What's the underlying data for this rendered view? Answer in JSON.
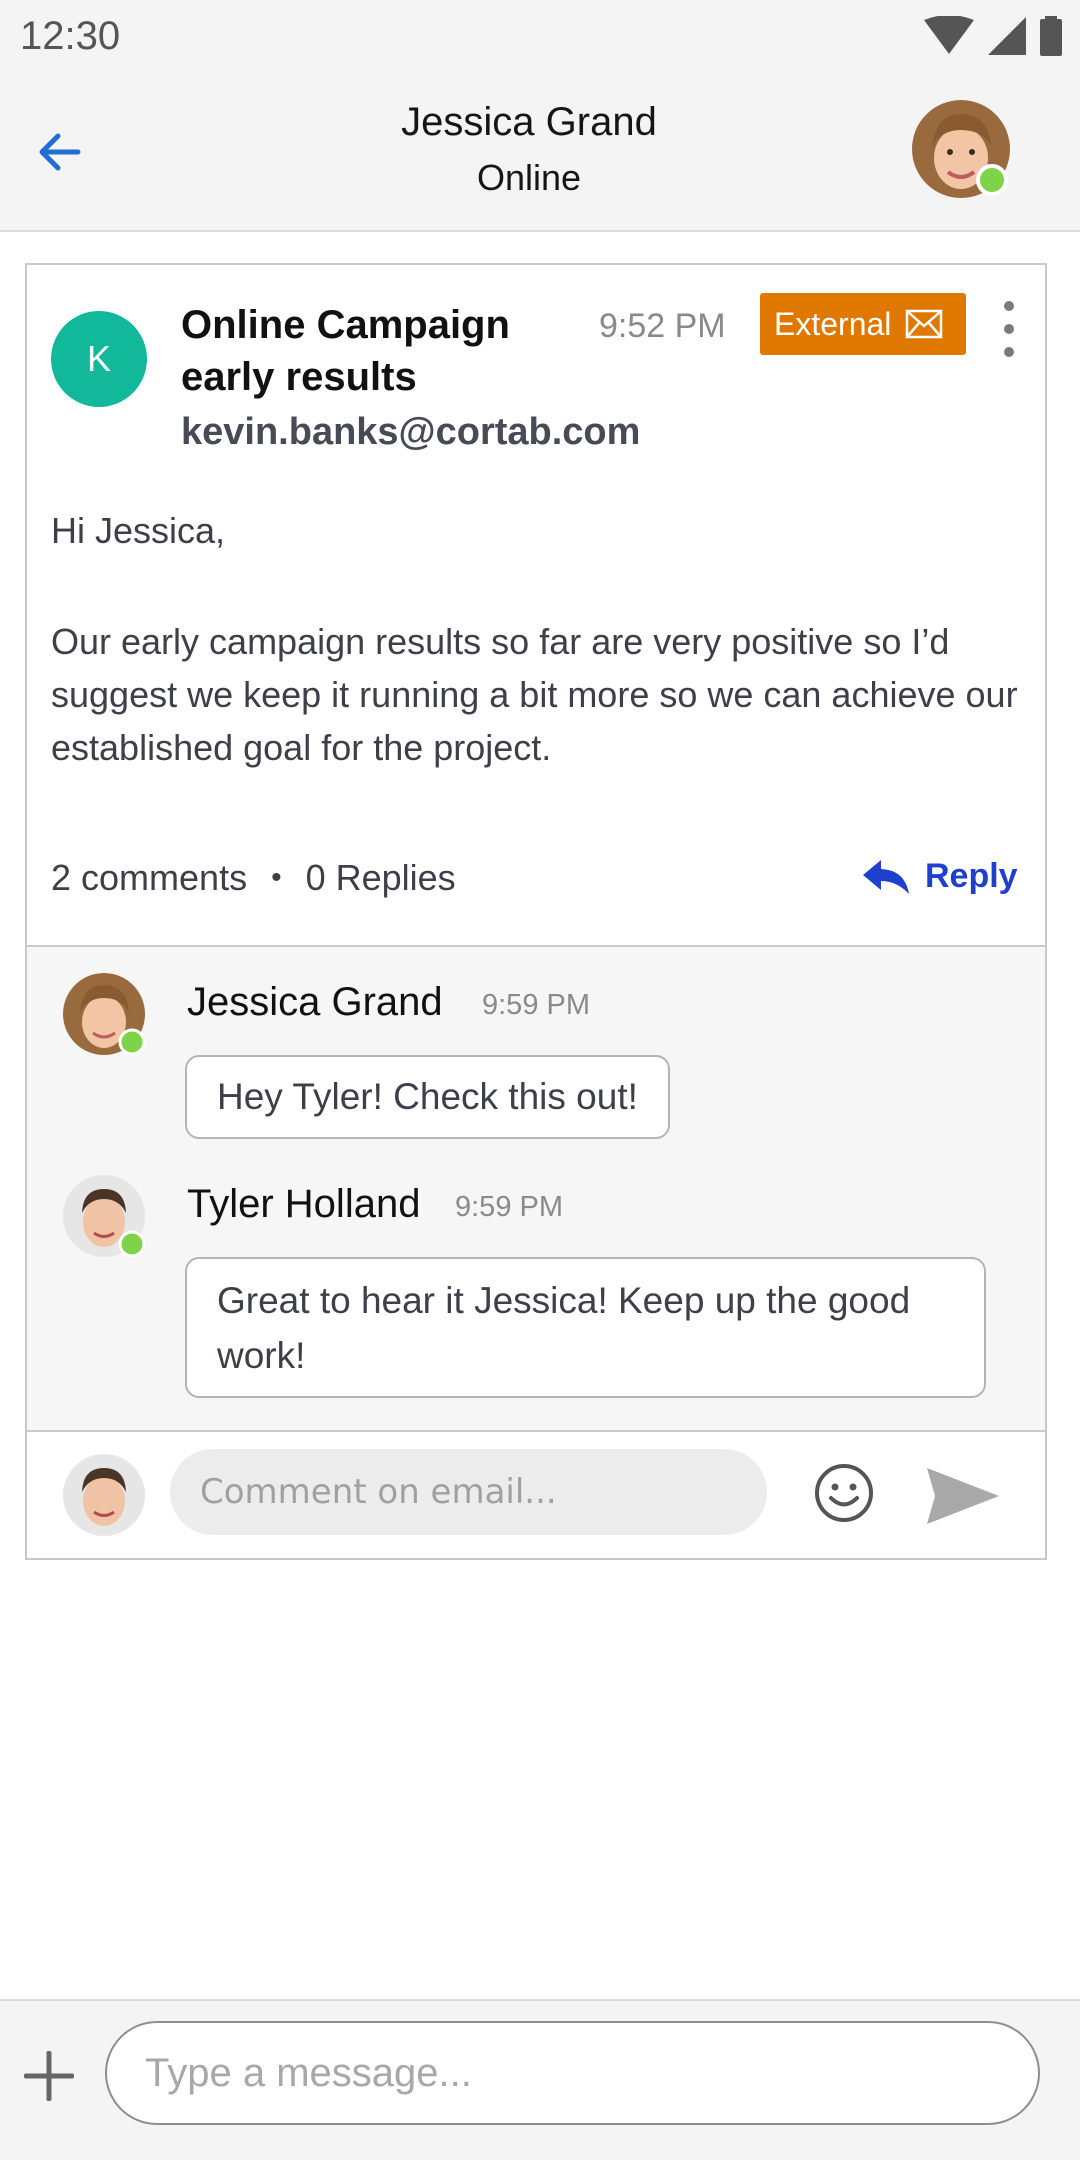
{
  "status_bar": {
    "time": "12:30",
    "icons": [
      "wifi-icon",
      "signal-icon",
      "battery-icon"
    ]
  },
  "header": {
    "contact_name": "Jessica Grand",
    "contact_status": "Online"
  },
  "email": {
    "sender_initial": "K",
    "subject": "Online Campaign early results",
    "time": "9:52 PM",
    "badge_label": "External",
    "sender_email": "kevin.banks@cortab.com",
    "greeting": "Hi Jessica,",
    "body": "Our early campaign results so far are very positive so I’d suggest we keep it running a bit more so we can achieve our established goal for the project.",
    "comments_count": "2 comments",
    "separator": "•",
    "replies_count": "0 Replies",
    "reply_label": "Reply"
  },
  "comments": [
    {
      "author": "Jessica Grand",
      "time": "9:59 PM",
      "text": "Hey Tyler! Check this out!"
    },
    {
      "author": "Tyler Holland",
      "time": "9:59 PM",
      "text": "Great to hear it Jessica! Keep up the good work!"
    }
  ],
  "comment_input": {
    "placeholder": "Comment on email..."
  },
  "compose": {
    "placeholder": "Type a message..."
  },
  "colors": {
    "accent": "#1f6fd0",
    "reply_blue": "#1f3fcf",
    "online_green": "#7ed348",
    "external_orange": "#e07800",
    "sender_avatar_teal": "#12b89a"
  }
}
